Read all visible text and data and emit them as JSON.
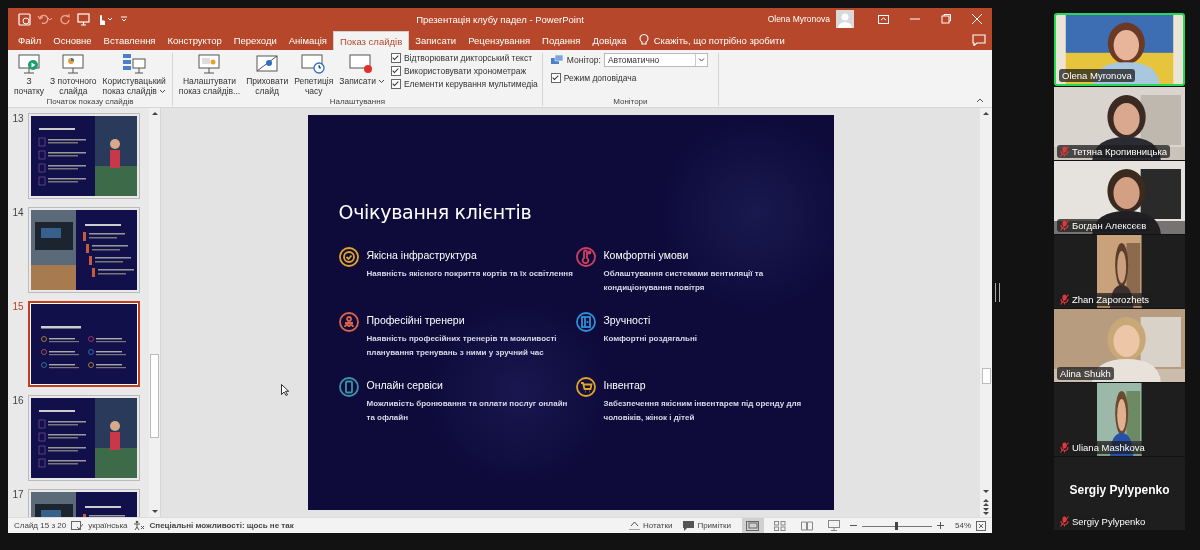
{
  "window": {
    "title": "Презентація клубу падел  -  PowerPoint",
    "user": "Olena Myronova"
  },
  "tabs": [
    {
      "label": "Файл",
      "selected": false
    },
    {
      "label": "Основне",
      "selected": false
    },
    {
      "label": "Вставлення",
      "selected": false
    },
    {
      "label": "Конструктор",
      "selected": false
    },
    {
      "label": "Переходи",
      "selected": false
    },
    {
      "label": "Анімація",
      "selected": false
    },
    {
      "label": "Показ слайдів",
      "selected": true
    },
    {
      "label": "Записати",
      "selected": false
    },
    {
      "label": "Рецензування",
      "selected": false
    },
    {
      "label": "Подання",
      "selected": false
    },
    {
      "label": "Довідка",
      "selected": false
    }
  ],
  "tell_me": "Скажіть, що потрібно зробити",
  "ribbon": [
    {
      "label": "Початок показу слайдів",
      "items": [
        {
          "kind": "large",
          "lines": [
            "З",
            "початку"
          ],
          "dropdown": false
        },
        {
          "kind": "large",
          "lines": [
            "З поточного",
            "слайда"
          ],
          "dropdown": false
        },
        {
          "kind": "large",
          "lines": [
            "Користувацький",
            "показ слайдів"
          ],
          "dropdown": true
        }
      ]
    },
    {
      "label": "Налаштування",
      "items": [
        {
          "kind": "large",
          "lines": [
            "Налаштувати",
            "показ слайдів..."
          ],
          "dropdown": false
        },
        {
          "kind": "large",
          "lines": [
            "Приховати",
            "слайд"
          ],
          "dropdown": false
        },
        {
          "kind": "large",
          "lines": [
            "Репетиція",
            "часу"
          ],
          "dropdown": false
        },
        {
          "kind": "large",
          "lines": [
            "Записати"
          ],
          "dropdown": true
        },
        {
          "kind": "checks",
          "options": [
            {
              "label": "Відтворювати дикторський текст",
              "checked": true
            },
            {
              "label": "Використовувати хронометраж",
              "checked": true
            },
            {
              "label": "Елементи керування мультимедіа",
              "checked": true
            }
          ]
        }
      ]
    },
    {
      "label": "Монітори",
      "items": [
        {
          "kind": "monitor",
          "label": "Монітор:",
          "value": "Автоматично",
          "options": [
            {
              "label": "Режим доповідача",
              "checked": true
            }
          ]
        }
      ]
    }
  ],
  "thumbnails": [
    {
      "number": "13",
      "selected": false,
      "kind": "photo-right"
    },
    {
      "number": "14",
      "selected": false,
      "kind": "photo-left"
    },
    {
      "number": "15",
      "selected": true,
      "kind": "text"
    },
    {
      "number": "16",
      "selected": false,
      "kind": "photo-right"
    },
    {
      "number": "17",
      "selected": false,
      "kind": "photo-left"
    }
  ],
  "slide": {
    "title": "Очікування клієнтів",
    "features": [
      {
        "heading": "Якісна інфраструктура",
        "text": "Наявність якісного покриття кортів та їх освітлення",
        "color": "#e0a526"
      },
      {
        "heading": "Комфортні умови",
        "text": "Облаштування системами вентиляції та кондиціонування повітря",
        "color": "#d0405e"
      },
      {
        "heading": "Професійні тренери",
        "text": "Наявність професійних тренерів та можливості планування тренувань з ними у зручний час",
        "color": "#d8654a"
      },
      {
        "heading": "Зручності",
        "text": "Комфортні роздягальні",
        "color": "#2f8fd8"
      },
      {
        "heading": "Онлайн сервіси",
        "text": "Можливість бронювання та оплати послуг онлайн та офлайн",
        "color": "#3d93a8"
      },
      {
        "heading": "Інвентар",
        "text": "Забезпечення якісним інвентарем під оренду для чоловіків, жінок і дітей",
        "color": "#e0a526"
      }
    ]
  },
  "status_bar": {
    "slide": "Слайд 15 з 20",
    "language": "українська",
    "accessibility": "Спеціальні можливості: щось не так",
    "notes": "Нотатки",
    "comments": "Примітки",
    "views": [
      {
        "kind": "normal",
        "selected": true
      },
      {
        "kind": "sorter",
        "selected": false
      },
      {
        "kind": "reading",
        "selected": false
      },
      {
        "kind": "show",
        "selected": false
      }
    ],
    "zoom": {
      "label": "54%",
      "level": 0.5
    }
  },
  "participants": [
    {
      "name": "Olena Myronova",
      "muted": false,
      "speaking": true,
      "kind": "video"
    },
    {
      "name": "Тетяна Кропивницька",
      "muted": true,
      "speaking": false,
      "kind": "video"
    },
    {
      "name": "Богдан Алексєєв",
      "muted": true,
      "speaking": false,
      "kind": "video"
    },
    {
      "name": "Zhan Zaporozhets",
      "muted": true,
      "speaking": false,
      "kind": "narrow-video"
    },
    {
      "name": "Alina Shukh",
      "muted": false,
      "speaking": false,
      "kind": "video"
    },
    {
      "name": "Uliana Mashkova",
      "muted": true,
      "speaking": false,
      "kind": "narrow-video"
    },
    {
      "name": "Sergiy Pylypenko",
      "muted": true,
      "speaking": false,
      "kind": "camera-off",
      "display_name": "Sergiy Pylypenko"
    }
  ]
}
